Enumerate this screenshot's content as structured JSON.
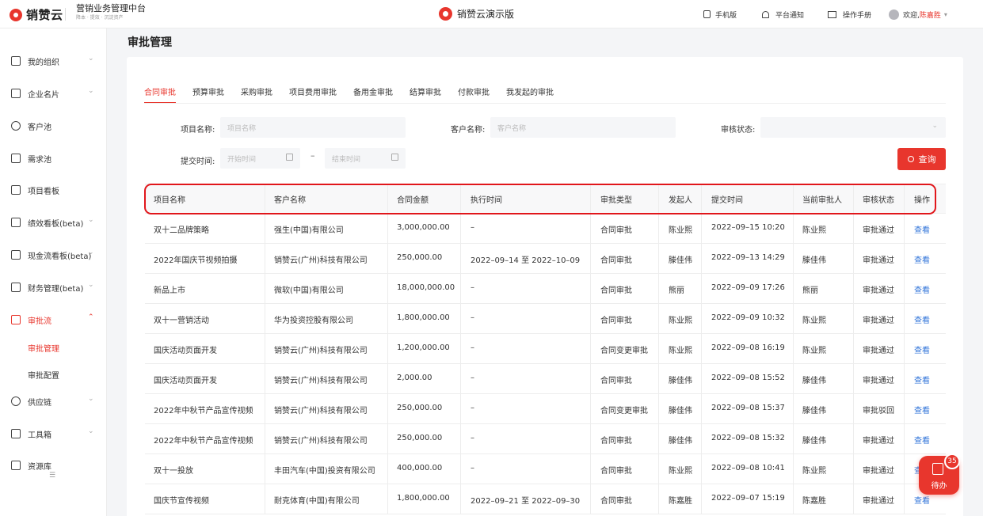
{
  "header": {
    "logo_text": "销赞云",
    "platform_title": "营销业务管理中台",
    "platform_subtitle": "降本 · 提效 · 沉淀资产",
    "center_title": "销赞云演示版",
    "mobile": "手机版",
    "notice": "平台通知",
    "manual": "操作手册",
    "welcome": "欢迎,",
    "user": "陈嘉胜"
  },
  "sidebar": {
    "items": [
      {
        "label": "我的组织",
        "icon": "user-box-icon"
      },
      {
        "label": "企业名片",
        "icon": "building-icon"
      },
      {
        "label": "客户池",
        "icon": "person-icon"
      },
      {
        "label": "需求池",
        "icon": "document-icon"
      },
      {
        "label": "项目看板",
        "icon": "columns-icon"
      },
      {
        "label": "绩效看板(beta)",
        "icon": "bar-chart-icon"
      },
      {
        "label": "现金流看板(beta)",
        "icon": "currency-icon"
      },
      {
        "label": "财务管理(beta)",
        "icon": "wallet-icon"
      },
      {
        "label": "审批流",
        "icon": "stamp-icon"
      },
      {
        "label": "供应链",
        "icon": "network-icon"
      },
      {
        "label": "工具箱",
        "icon": "toolbox-icon"
      },
      {
        "label": "资源库",
        "icon": "folder-icon"
      }
    ],
    "sub_items": [
      "审批管理",
      "审批配置"
    ]
  },
  "page_title": "审批管理",
  "tabs": [
    "合同审批",
    "预算审批",
    "采购审批",
    "项目费用审批",
    "备用金审批",
    "结算审批",
    "付款审批",
    "我发起的审批"
  ],
  "filters": {
    "project_label": "项目名称:",
    "project_placeholder": "项目名称",
    "customer_label": "客户名称:",
    "customer_placeholder": "客户名称",
    "status_label": "审核状态:",
    "time_label": "提交时间:",
    "start_placeholder": "开始时间",
    "end_placeholder": "结束时间",
    "range_sep": "–",
    "query_label": "查询"
  },
  "table": {
    "columns": [
      "项目名称",
      "客户名称",
      "合同金额",
      "执行时间",
      "审批类型",
      "发起人",
      "提交时间",
      "当前审批人",
      "审核状态",
      "操作"
    ],
    "rows": [
      [
        "双十二品牌策略",
        "强生(中国)有限公司",
        "3,000,000.00",
        "–",
        "合同审批",
        "陈业熙",
        "2022–09–15 10:20",
        "陈业熙",
        "审批通过",
        "查看"
      ],
      [
        "2022年国庆节视频拍摄",
        "销赞云(广州)科技有限公司",
        "250,000.00",
        "2022–09–14 至 2022–10–09",
        "合同审批",
        "滕佳伟",
        "2022–09–13 14:29",
        "滕佳伟",
        "审批通过",
        "查看"
      ],
      [
        "新品上市",
        "微软(中国)有限公司",
        "18,000,000.00",
        "–",
        "合同审批",
        "熊丽",
        "2022–09–09 17:26",
        "熊丽",
        "审批通过",
        "查看"
      ],
      [
        "双十一营销活动",
        "华为投资控股有限公司",
        "1,800,000.00",
        "–",
        "合同审批",
        "陈业熙",
        "2022–09–09 10:32",
        "陈业熙",
        "审批通过",
        "查看"
      ],
      [
        "国庆活动页面开发",
        "销赞云(广州)科技有限公司",
        "1,200,000.00",
        "–",
        "合同变更审批",
        "陈业熙",
        "2022–09–08 16:19",
        "陈业熙",
        "审批通过",
        "查看"
      ],
      [
        "国庆活动页面开发",
        "销赞云(广州)科技有限公司",
        "2,000.00",
        "–",
        "合同审批",
        "滕佳伟",
        "2022–09–08 15:52",
        "滕佳伟",
        "审批通过",
        "查看"
      ],
      [
        "2022年中秋节产品宣传视频",
        "销赞云(广州)科技有限公司",
        "250,000.00",
        "–",
        "合同变更审批",
        "滕佳伟",
        "2022–09–08 15:37",
        "滕佳伟",
        "审批驳回",
        "查看"
      ],
      [
        "2022年中秋节产品宣传视频",
        "销赞云(广州)科技有限公司",
        "250,000.00",
        "–",
        "合同审批",
        "滕佳伟",
        "2022–09–08 15:32",
        "滕佳伟",
        "审批通过",
        "查看"
      ],
      [
        "双十一投放",
        "丰田汽车(中国)投资有限公司",
        "400,000.00",
        "–",
        "合同审批",
        "陈业熙",
        "2022–09–08 10:41",
        "陈业熙",
        "审批通过",
        "查看"
      ],
      [
        "国庆节宣传视频",
        "耐克体育(中国)有限公司",
        "1,800,000.00",
        "2022–09–21 至 2022–09–30",
        "合同审批",
        "陈嘉胜",
        "2022–09–07 15:19",
        "陈嘉胜",
        "审批通过",
        "查看"
      ]
    ]
  },
  "float_button": {
    "label": "待办",
    "badge": "35"
  },
  "colors": {
    "accent": "#e8362d",
    "link": "#2f73d9",
    "highlight": "#e1161b"
  }
}
